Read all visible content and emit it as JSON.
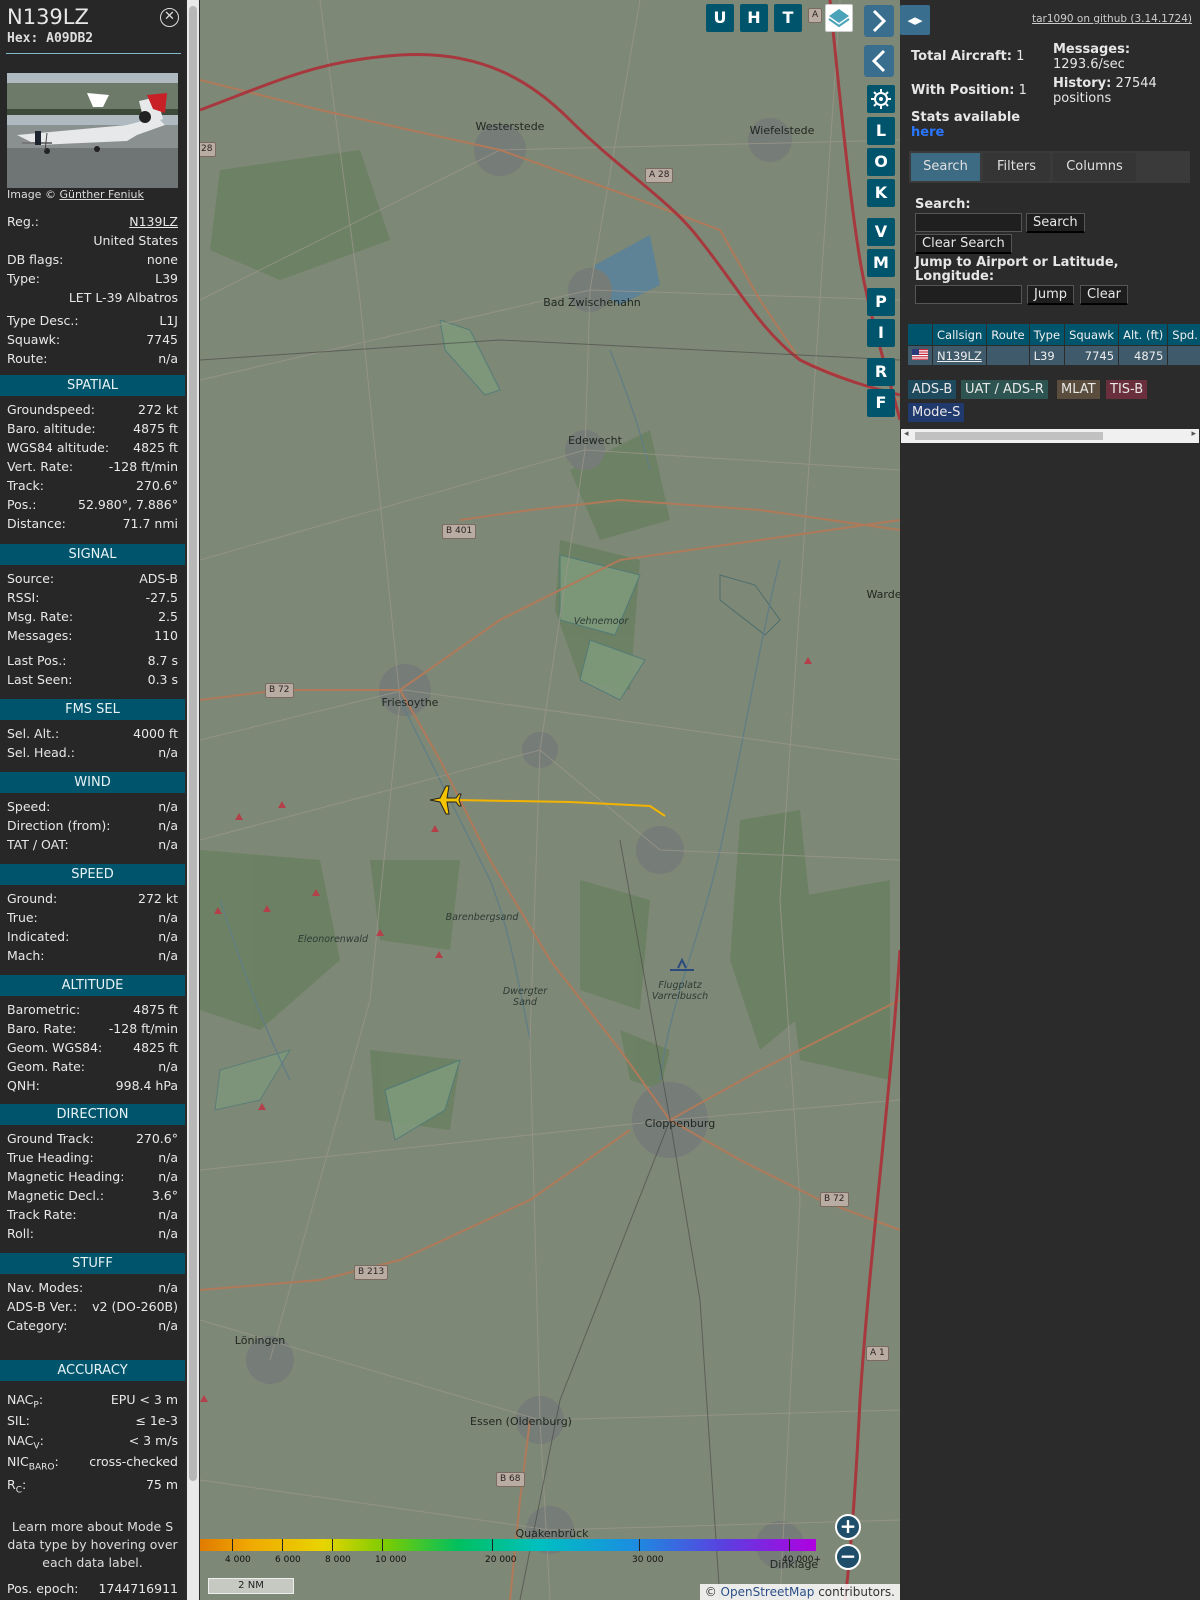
{
  "aircraft": {
    "registration": "N139LZ",
    "hex_label": "Hex:",
    "hex": "A09DB2",
    "photo_credit_prefix": "Image © ",
    "photo_credit_name": "Günther Feniuk"
  },
  "details": {
    "reg_key": "Reg.:",
    "reg_val": "N139LZ",
    "country": "United States",
    "dbflags_key": "DB flags:",
    "dbflags_val": "none",
    "type_key": "Type:",
    "type_val": "L39",
    "type_full": "LET L-39 Albatros",
    "typedesc_key": "Type Desc.:",
    "typedesc_val": "L1J",
    "squawk_key": "Squawk:",
    "squawk_val": "7745",
    "route_key": "Route:",
    "route_val": "n/a"
  },
  "sections": {
    "spatial": "SPATIAL",
    "signal": "SIGNAL",
    "fms": "FMS SEL",
    "wind": "WIND",
    "speed": "SPEED",
    "altitude": "ALTITUDE",
    "direction": "DIRECTION",
    "stuff": "STUFF",
    "accuracy": "ACCURACY"
  },
  "spatial": [
    [
      "Groundspeed:",
      "272 kt"
    ],
    [
      "Baro. altitude:",
      "4875 ft"
    ],
    [
      "WGS84 altitude:",
      "4825 ft"
    ],
    [
      "Vert. Rate:",
      "-128 ft/min"
    ],
    [
      "Track:",
      "270.6°"
    ],
    [
      "Pos.:",
      "52.980°, 7.886°"
    ],
    [
      "Distance:",
      "71.7 nmi"
    ]
  ],
  "signal": [
    [
      "Source:",
      "ADS-B"
    ],
    [
      "RSSI:",
      "-27.5"
    ],
    [
      "Msg. Rate:",
      "2.5"
    ],
    [
      "Messages:",
      "110"
    ],
    [
      "Last Pos.:",
      "8.7 s"
    ],
    [
      "Last Seen:",
      "0.3 s"
    ]
  ],
  "fms": [
    [
      "Sel. Alt.:",
      "4000 ft"
    ],
    [
      "Sel. Head.:",
      "n/a"
    ]
  ],
  "wind": [
    [
      "Speed:",
      "n/a"
    ],
    [
      "Direction (from):",
      "n/a"
    ],
    [
      "TAT / OAT:",
      "n/a"
    ]
  ],
  "speed": [
    [
      "Ground:",
      "272 kt"
    ],
    [
      "True:",
      "n/a"
    ],
    [
      "Indicated:",
      "n/a"
    ],
    [
      "Mach:",
      "n/a"
    ]
  ],
  "altitude": [
    [
      "Barometric:",
      "4875 ft"
    ],
    [
      "Baro. Rate:",
      "-128 ft/min"
    ],
    [
      "Geom. WGS84:",
      "4825 ft"
    ],
    [
      "Geom. Rate:",
      "n/a"
    ],
    [
      "QNH:",
      "998.4 hPa"
    ]
  ],
  "direction": [
    [
      "Ground Track:",
      "270.6°"
    ],
    [
      "True Heading:",
      "n/a"
    ],
    [
      "Magnetic Heading:",
      "n/a"
    ],
    [
      "Magnetic Decl.:",
      "3.6°"
    ],
    [
      "Track Rate:",
      "n/a"
    ],
    [
      "Roll:",
      "n/a"
    ]
  ],
  "stuff": [
    [
      "Nav. Modes:",
      "n/a"
    ],
    [
      "ADS-B Ver.:",
      "v2 (DO-260B)"
    ],
    [
      "Category:",
      "n/a"
    ]
  ],
  "accuracy": {
    "nacp_key": "NAC",
    "nacp_sub": "P",
    "nacp_val": "EPU < 3 m",
    "sil_key": "SIL:",
    "sil_val": "≤ 1e-3",
    "nacv_key": "NAC",
    "nacv_sub": "V",
    "nacv_val": "< 3 m/s",
    "nicbaro_key": "NIC",
    "nicbaro_sub": "BARO",
    "nicbaro_val": "cross-checked",
    "rc_key": "R",
    "rc_sub": "C",
    "rc_val": "75 m"
  },
  "learn_more": "Learn more about Mode S data type by hovering over each data label.",
  "pos_epoch": [
    "Pos. epoch:",
    "1744716911"
  ],
  "map": {
    "places": {
      "westerstede": "Westerstede",
      "wiefelstede": "Wiefelstede",
      "bad_zwischenahn": "Bad Zwischenahn",
      "edewecht": "Edewecht",
      "friesoythe": "Friesoythe",
      "vehnemoor": "Vehnemoor",
      "barenbergsand": "Barenbergsand",
      "eleonorenwald": "Eleonorenwald",
      "dwergter_sand_1": "Dwergter",
      "dwergter_sand_2": "Sand",
      "flugplatz_1": "Flugplatz",
      "flugplatz_2": "Varrelbusch",
      "cloppenburg": "Cloppenburg",
      "loningen": "Löningen",
      "essen": "Essen (Oldenburg)",
      "quakenbruck": "Quakenbrück",
      "dinklage": "Dinklage",
      "warde": "Warde"
    },
    "roads": {
      "a28": "A 28",
      "b401": "B 401",
      "b72_w": "B 72",
      "b72_e": "B 72",
      "b213": "B 213",
      "b68": "B 68",
      "a1": "A 1",
      "r28": "28",
      "ra": "A"
    },
    "buttons": [
      "U",
      "H",
      "T",
      "L",
      "O",
      "K",
      "V",
      "M",
      "P",
      "I",
      "R",
      "F"
    ],
    "zoom_in": "+",
    "zoom_out": "−",
    "altitude_labels": [
      "4 000",
      "6 000",
      "8 000",
      "10 000",
      "20 000",
      "30 000",
      "40 000+"
    ],
    "scale": "2 NM",
    "attribution_prefix": "© ",
    "attribution_link": "OpenStreetMap",
    "attribution_suffix": " contributors."
  },
  "right": {
    "github": "tar1090 on github (3.14.1724)",
    "total_aircraft_label": "Total Aircraft:",
    "total_aircraft": "1",
    "with_position_label": "With Position:",
    "with_position": "1",
    "messages_label": "Messages:",
    "messages": "1293.6/sec",
    "history_label": "History:",
    "history": "27544 positions",
    "stats_label": "Stats available",
    "stats_link": "here",
    "tabs": [
      "Search",
      "Filters",
      "Columns"
    ],
    "search_label": "Search:",
    "search_button": "Search",
    "clear_search": "Clear Search",
    "jump_label": "Jump to Airport or Latitude, Longitude:",
    "jump_button": "Jump",
    "clear_button": "Clear",
    "columns": [
      "",
      "Callsign",
      "Route",
      "Type",
      "Squawk",
      "Alt. (ft)",
      "Spd."
    ],
    "rows": [
      {
        "flag": "us-flag",
        "callsign": "N139LZ",
        "route": "",
        "type": "L39",
        "squawk": "7745",
        "alt": "4875",
        "spd": ""
      }
    ],
    "legend": [
      "ADS-B",
      "UAT / ADS-R",
      "MLAT",
      "TIS-B",
      "Mode-S"
    ]
  },
  "colors": {
    "accent": "#00546b",
    "panel_bg": "#272727",
    "track": "#f2b400",
    "aircraft": "#f5c400",
    "adsb": "#1f4a5e",
    "uat": "#2d5450",
    "mlat": "#5a4d3d",
    "tisb": "#6a2f3c",
    "modes": "#213a6e"
  }
}
